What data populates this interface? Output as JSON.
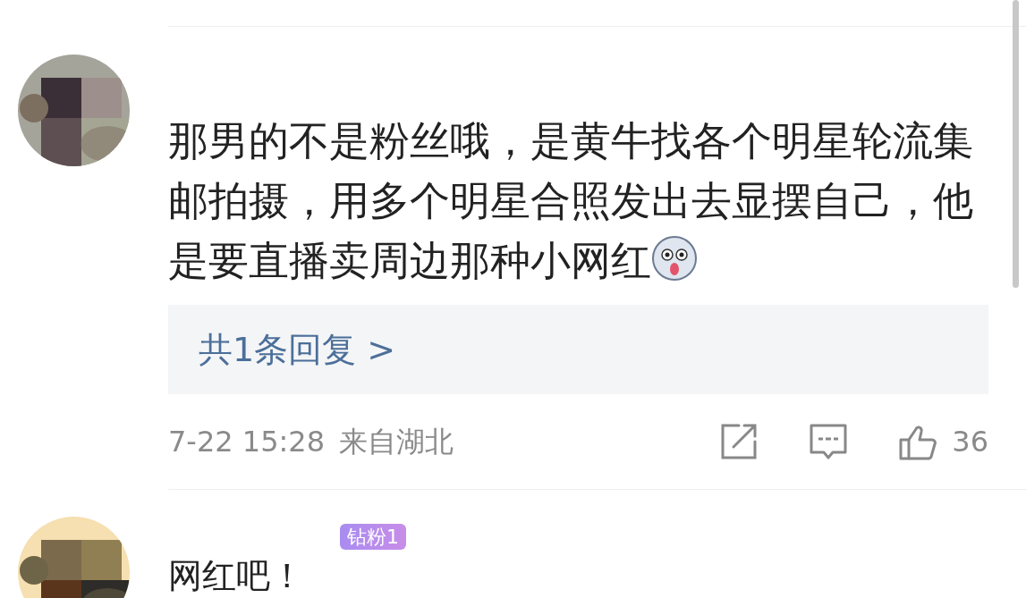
{
  "comments": [
    {
      "text": "那男的不是粉丝哦，是黄牛找各个明星轮流集邮拍摄，用多个明星合照发出去显摆自己，他是要直播卖周边那种小网红",
      "emoji": true,
      "reply_link": "共1条回复 >",
      "time": "7-22 15:28",
      "location": "来自湖北",
      "likes": "36"
    },
    {
      "badge": "钻粉1",
      "text": "网红吧！"
    }
  ]
}
